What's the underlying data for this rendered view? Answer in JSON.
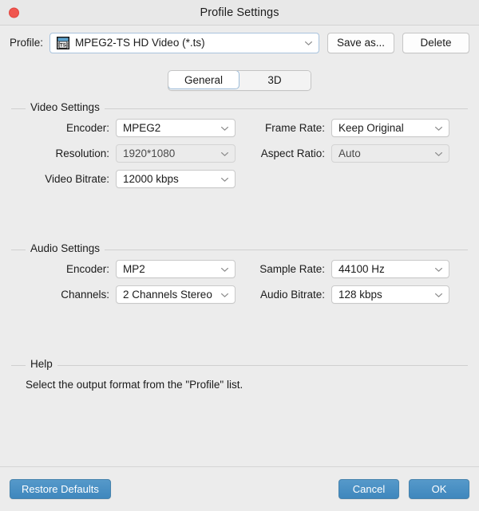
{
  "window": {
    "title": "Profile Settings",
    "close_button": "close"
  },
  "profile_row": {
    "label": "Profile:",
    "selected_profile": "MPEG2-TS HD Video (*.ts)",
    "icon_text": "TS",
    "save_as_label": "Save as...",
    "delete_label": "Delete"
  },
  "tabs": [
    {
      "label": "General",
      "active": true
    },
    {
      "label": "3D",
      "active": false
    }
  ],
  "video_settings": {
    "title": "Video Settings",
    "fields": [
      {
        "label": "Encoder:",
        "value": "MPEG2"
      },
      {
        "label": "Resolution:",
        "value": "1920*1080"
      },
      {
        "label": "Video Bitrate:",
        "value": "12000 kbps"
      },
      {
        "label": "Frame Rate:",
        "value": "Keep Original"
      },
      {
        "label": "Aspect Ratio:",
        "value": "Auto"
      }
    ]
  },
  "audio_settings": {
    "title": "Audio Settings",
    "fields": [
      {
        "label": "Encoder:",
        "value": "MP2"
      },
      {
        "label": "Channels:",
        "value": "2 Channels Stereo"
      },
      {
        "label": "Sample Rate:",
        "value": "44100 Hz"
      },
      {
        "label": "Audio Bitrate:",
        "value": "128 kbps"
      }
    ]
  },
  "help": {
    "title": "Help",
    "text": "Select the output format from the \"Profile\" list."
  },
  "footer": {
    "restore_defaults_label": "Restore Defaults",
    "cancel_label": "Cancel",
    "ok_label": "OK"
  },
  "colors": {
    "accent_blue": "#4a90c4",
    "close_red": "#f0564f",
    "window_bg": "#ececec",
    "focus_border": "#a8c3dd"
  }
}
